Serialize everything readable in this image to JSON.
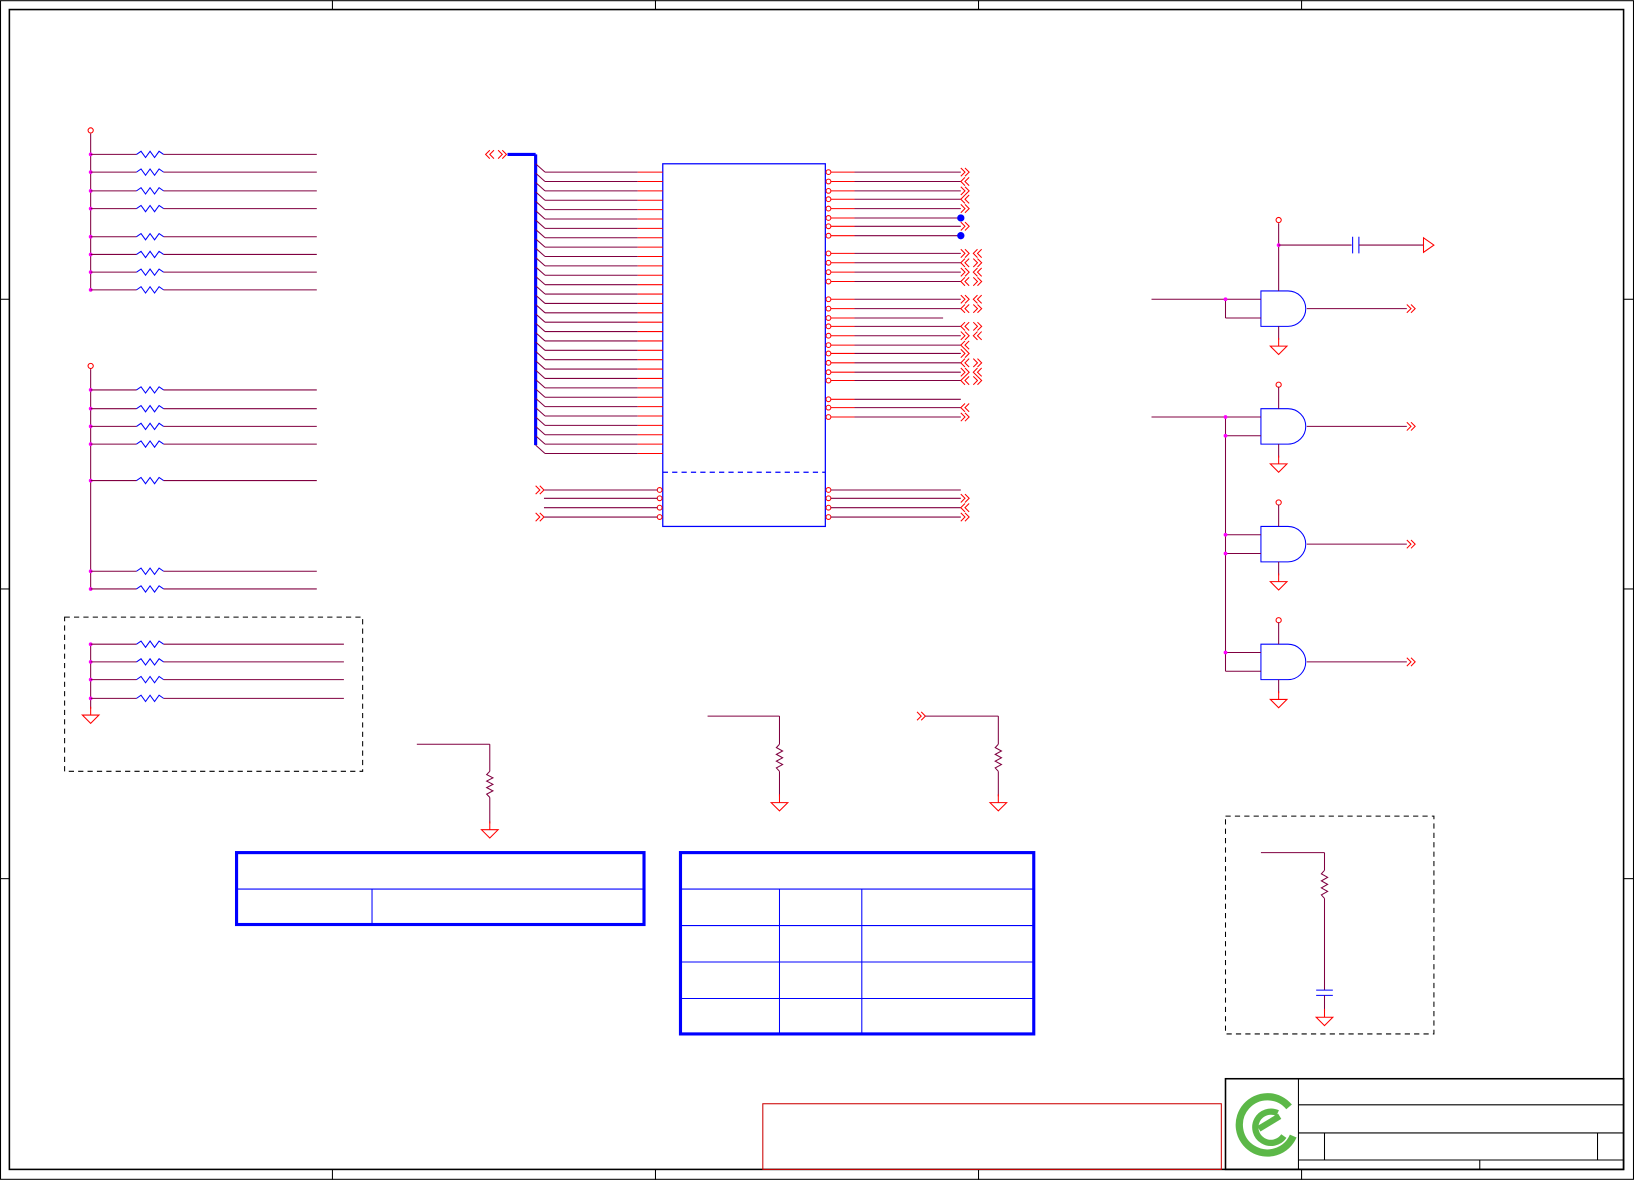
{
  "schematic": {
    "title_block": {
      "title": "",
      "sheet": "",
      "revision": ""
    },
    "logo": {
      "name": "green-e-logo",
      "color": "#5cb848"
    },
    "colors": {
      "border": "#000000",
      "wire": "#800040",
      "pin": "#ff0000",
      "component": "#0000ff",
      "junction": "#ff00ff",
      "note_box": "#cc0000"
    },
    "icons": [
      "resistor-icon",
      "capacitor-icon",
      "ground-icon",
      "and-gate-icon",
      "offpage-connector-icon",
      "power-pin-icon"
    ]
  }
}
